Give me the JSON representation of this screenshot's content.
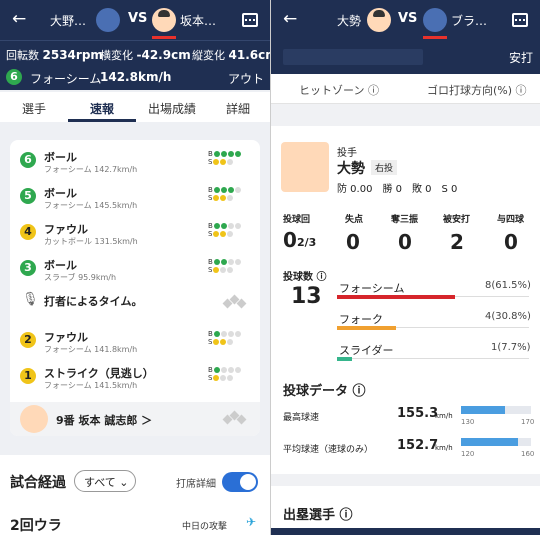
{
  "left": {
    "header": {
      "away_name": "大野…",
      "vs": "VS",
      "home_name": "坂本…"
    },
    "stats": {
      "spin_label": "回転数",
      "spin": "2534rpm",
      "hbreak_label": "横変化",
      "hbreak": "-42.9cm",
      "vbreak_label": "縦変化",
      "vbreak": "41.6cm"
    },
    "pitch": {
      "num": "6",
      "type": "フォーシーム",
      "speed": "142.8km/h",
      "result": "アウト"
    },
    "tabs": [
      "選手",
      "速報",
      "出場成績",
      "詳細"
    ],
    "events": [
      {
        "num": "6",
        "title": "ボール",
        "sub": "フォーシーム 142.7km/h",
        "color": "#2fa84f"
      },
      {
        "num": "5",
        "title": "ボール",
        "sub": "フォーシーム 145.5km/h",
        "color": "#2fa84f"
      },
      {
        "num": "4",
        "title": "ファウル",
        "sub": "カットボール 131.5km/h",
        "color": "#f0c419"
      },
      {
        "num": "3",
        "title": "ボール",
        "sub": "スラーブ 95.9km/h",
        "color": "#2fa84f"
      },
      {
        "num": "",
        "title": "打者によるタイム。",
        "sub": "",
        "color": ""
      },
      {
        "num": "2",
        "title": "ファウル",
        "sub": "フォーシーム 141.8km/h",
        "color": "#f0c419"
      },
      {
        "num": "1",
        "title": "ストライク（見逃し）",
        "sub": "フォーシーム 141.5km/h",
        "color": "#f0c419"
      }
    ],
    "batter": "9番 坂本 誠志郎 ＞",
    "flow": {
      "title": "試合経過",
      "filter": "すべて",
      "detail": "打席詳細",
      "inning": "2回ウラ",
      "attack": "中日の攻撃"
    }
  },
  "right": {
    "header": {
      "away_name": "大勢",
      "vs": "VS",
      "home_name": "ブラ…"
    },
    "top": {
      "result": "安打",
      "hot_zone": "ヒットゾーン ⓘ",
      "ground": "ゴロ打球方向(%) ⓘ"
    },
    "pitcher": {
      "role": "投手",
      "name": "大勢",
      "hand": "右投",
      "record": "防 0.00　勝 0　敗 0　S 0"
    },
    "stats": {
      "ip_label": "投球回",
      "ip": "0",
      "ip_frac": "2/3",
      "er_label": "失点",
      "er": "0",
      "so_label": "奪三振",
      "so": "0",
      "h_label": "被安打",
      "h": "2",
      "bb_label": "与四球",
      "bb": "0"
    },
    "pitches": {
      "label": "投球数 ⓘ",
      "count": "13",
      "mix": [
        {
          "name": "フォーシーム",
          "value": "8(61.5%)",
          "pct": 61.5,
          "color": "#d6252b"
        },
        {
          "name": "フォーク",
          "value": "4(30.8%)",
          "pct": 30.8,
          "color": "#f0a030"
        },
        {
          "name": "スライダー",
          "value": "1(7.7%)",
          "pct": 7.7,
          "color": "#36b58c"
        }
      ]
    },
    "pitch_data": {
      "title": "投球データ ⓘ",
      "max_label": "最高球速",
      "max": "155.3",
      "avg_label": "平均球速（速球のみ）",
      "avg": "152.7",
      "unit": "km/h",
      "r1": [
        "130",
        "170"
      ],
      "r2": [
        "120",
        "160"
      ],
      "max_frac": 0.63,
      "avg_frac": 0.82
    },
    "baserunners": "出塁選手 ⓘ"
  }
}
